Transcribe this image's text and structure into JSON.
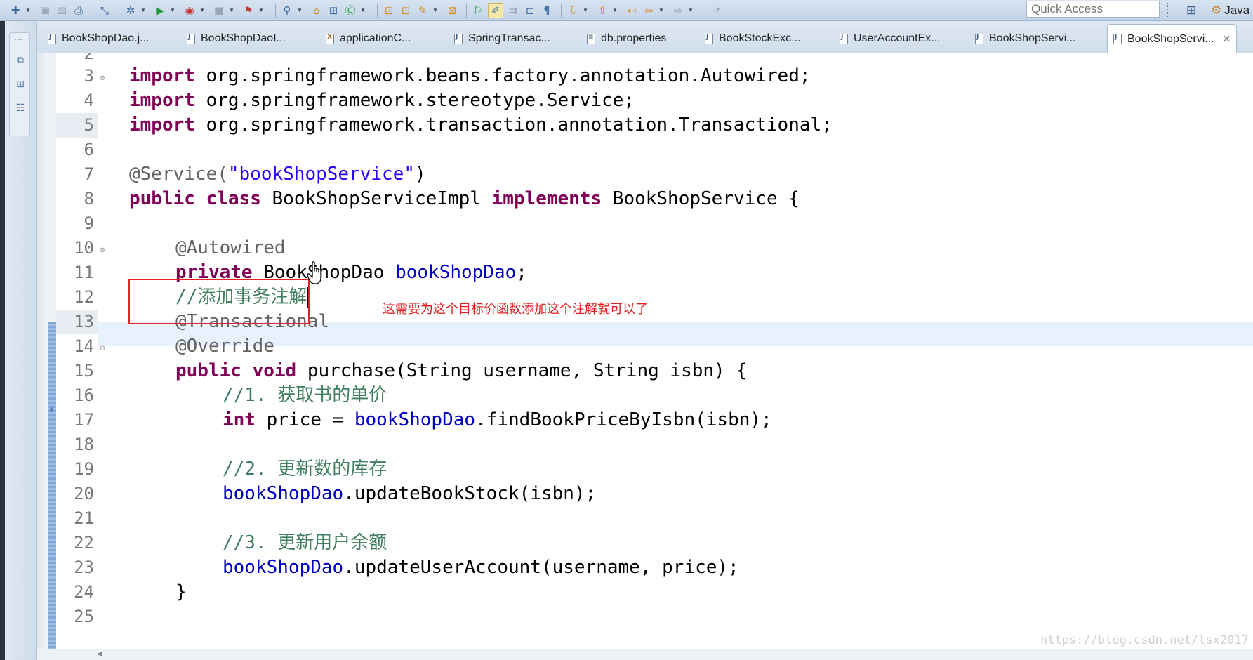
{
  "toolbar": {
    "quick_access_placeholder": "Quick Access",
    "perspective_label": "Java"
  },
  "tabs": [
    {
      "label": "BookShopDao.j...",
      "icon": "java-file-icon"
    },
    {
      "label": "BookShopDaoI...",
      "icon": "java-file-icon"
    },
    {
      "label": "applicationC...",
      "icon": "xml-file-icon"
    },
    {
      "label": "SpringTransac...",
      "icon": "java-file-icon"
    },
    {
      "label": "db.properties",
      "icon": "properties-file-icon"
    },
    {
      "label": "BookStockExc...",
      "icon": "java-file-icon"
    },
    {
      "label": "UserAccountEx...",
      "icon": "java-file-icon"
    },
    {
      "label": "BookShopServi...",
      "icon": "java-file-icon"
    },
    {
      "label": "BookShopServi...",
      "icon": "java-file-icon",
      "active": true
    }
  ],
  "editor": {
    "line_numbers": [
      "2",
      "3",
      "4",
      "5",
      "6",
      "7",
      "8",
      "9",
      "10",
      "11",
      "12",
      "13",
      "14",
      "15",
      "16",
      "17",
      "18",
      "19",
      "20",
      "21",
      "22",
      "23",
      "24",
      "25"
    ],
    "current_line": "13",
    "code": {
      "l3": {
        "kw": "import",
        "rest": " org.springframework.beans.factory.annotation.Autowired;"
      },
      "l4": {
        "kw": "import",
        "rest": " org.springframework.stereotype.Service;"
      },
      "l5": {
        "kw": "import",
        "rest": " org.springframework.transaction.annotation.Transactional;"
      },
      "l7": {
        "ann": "@Service(",
        "str": "\"bookShopService\"",
        "rest": ")"
      },
      "l8": {
        "kw1": "public",
        "kw2": "class",
        "name": " BookShopServiceImpl ",
        "kw3": "implements",
        "rest": " BookShopService {"
      },
      "l10": {
        "ann": "@Autowired"
      },
      "l11": {
        "kw": "private",
        "type": " BookShopDao ",
        "fld": "bookShopDao",
        "rest": ";"
      },
      "l13": {
        "cmt": "//添加事务注解"
      },
      "l14": {
        "ann": "@Transactional"
      },
      "l15": {
        "ann": "@Override"
      },
      "l16": {
        "kw1": "public",
        "kw2": "void",
        "rest": " purchase(String username, String isbn) {"
      },
      "l17": {
        "cmt": "//1. 获取书的单价"
      },
      "l18": {
        "kw": "int",
        "mid": " price = ",
        "fld": "bookShopDao",
        "rest": ".findBookPriceByIsbn(isbn);"
      },
      "l20": {
        "cmt": "//2. 更新数的库存"
      },
      "l21": {
        "fld": "bookShopDao",
        "rest": ".updateBookStock(isbn);"
      },
      "l23": {
        "cmt": "//3. 更新用户余额"
      },
      "l24": {
        "fld": "bookShopDao",
        "rest": ".updateUserAccount(username, price);"
      },
      "l25": {
        "rest": "}"
      }
    },
    "annotation_note": "这需要为这个目标价函数添加这个注解就可以了",
    "watermark": "https://blog.csdn.net/lsx2017"
  },
  "colors": {
    "keyword": "#7f0055",
    "annotation": "#646464",
    "string": "#2a00ff",
    "field": "#0000c0",
    "comment": "#3f7f5f",
    "highlight_box": "#e12323"
  }
}
